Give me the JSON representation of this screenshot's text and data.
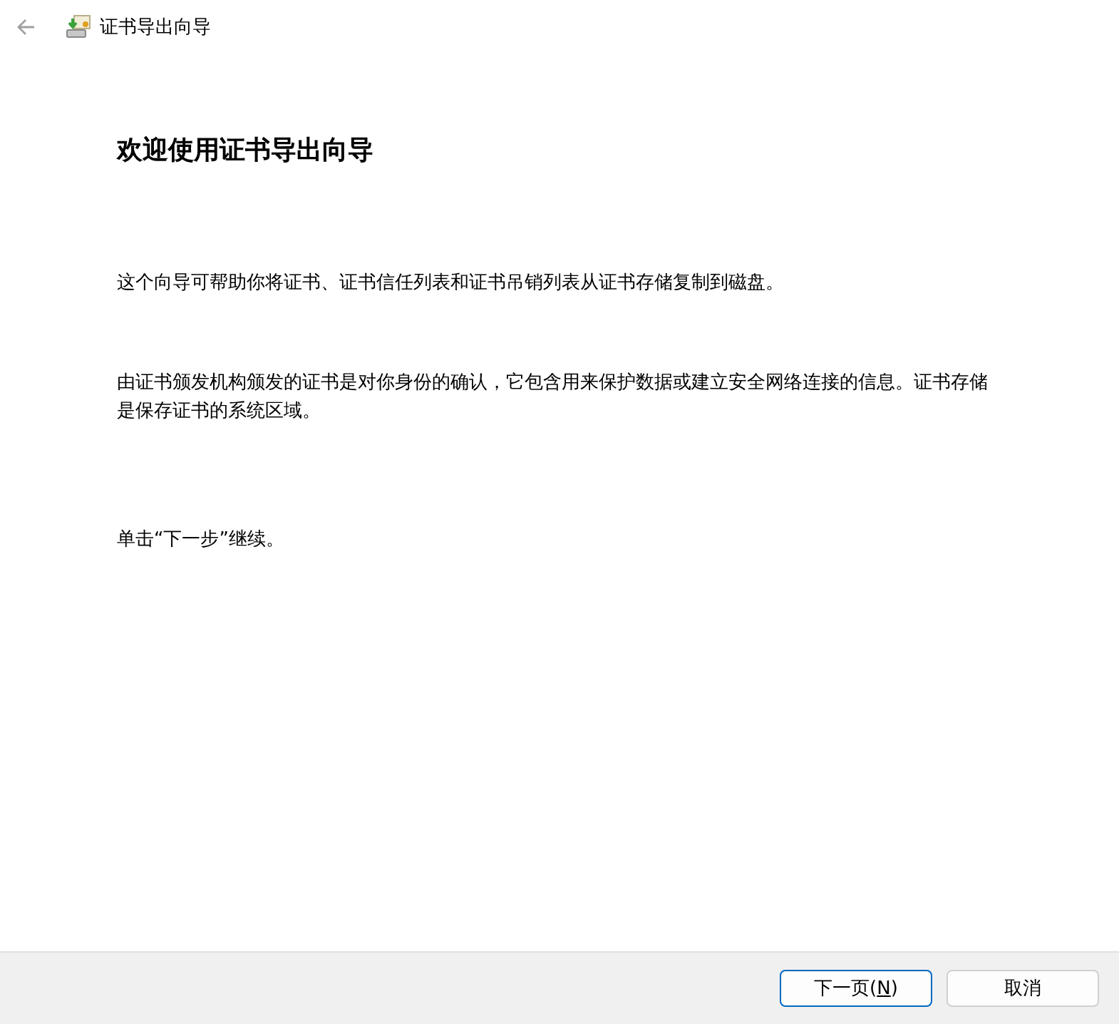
{
  "window": {
    "title": "证书导出向导",
    "back_disabled": true
  },
  "heading": "欢迎使用证书导出向导",
  "paragraphs": [
    "这个向导可帮助你将证书、证书信任列表和证书吊销列表从证书存储复制到磁盘。",
    "由证书颁发机构颁发的证书是对你身份的确认，它包含用来保护数据或建立安全网络连接的信息。证书存储是保存证书的系统区域。",
    "单击“下一步”继续。"
  ],
  "buttons": [
    {
      "before": "下一页(",
      "key": "N",
      "after": ")",
      "default": true
    },
    {
      "before": "取消",
      "default": false
    }
  ]
}
